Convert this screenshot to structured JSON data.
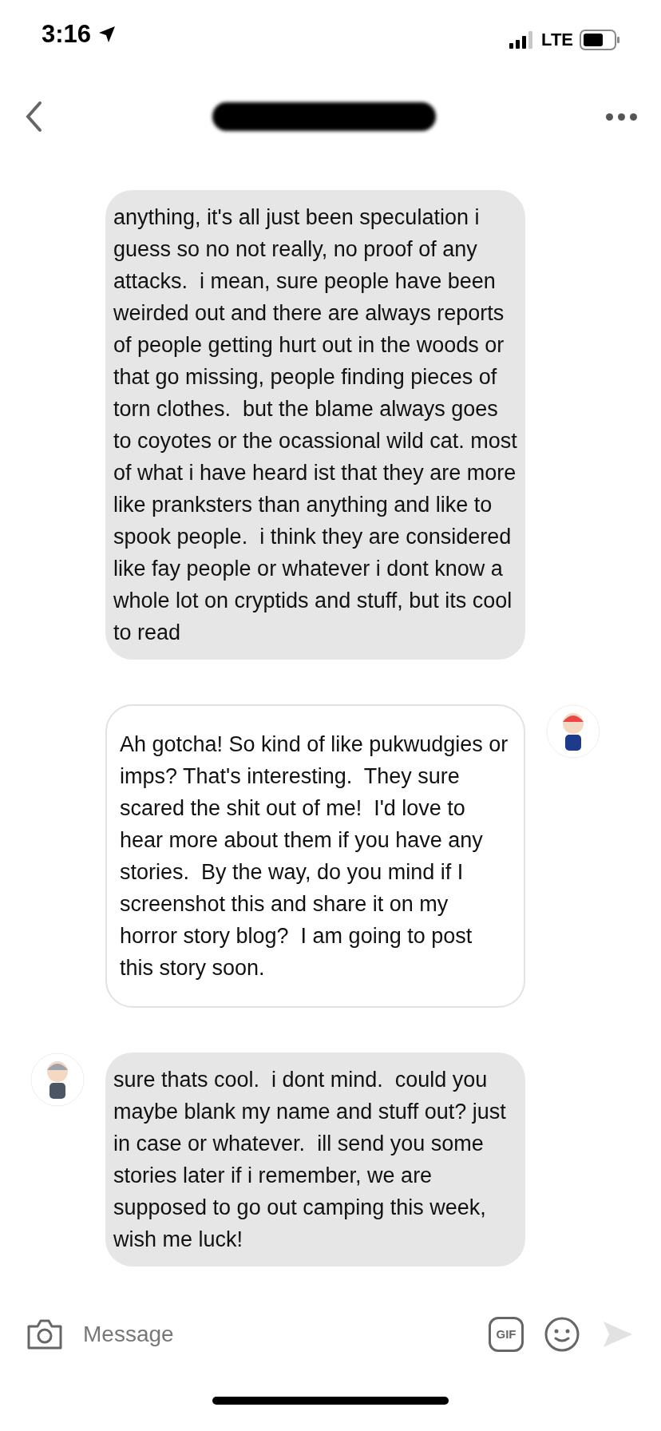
{
  "status_bar": {
    "time": "3:16",
    "network": "LTE"
  },
  "messages": [
    {
      "kind": "received",
      "avatar": false,
      "text": "anything, it's all just been speculation i guess so no not really, no proof of any attacks.  i mean, sure people have been weirded out and there are always reports of people getting hurt out in the woods or that go missing, people finding pieces of torn clothes.  but the blame always goes to coyotes or the ocassional wild cat. most of what i have heard ist that they are more like pranksters than anything and like to spook people.  i think they are considered like fay people or whatever i dont know a whole lot on cryptids and stuff, but its cool to read"
    },
    {
      "kind": "sent",
      "avatar": true,
      "text": "Ah gotcha! So kind of like pukwudgies or imps? That's interesting.  They sure scared the shit out of me!  I'd love to hear more about them if you have any stories.  By the way, do you mind if I screenshot this and share it on my horror story blog?  I am going to post this story soon."
    },
    {
      "kind": "received",
      "avatar": true,
      "text": "sure thats cool.  i dont mind.  could you maybe blank my name and stuff out? just in case or whatever.  ill send you some stories later if i remember, we are supposed to go out camping this week, wish me luck!"
    }
  ],
  "composer": {
    "placeholder": "Message",
    "gif_label": "GIF",
    "send_disabled": true
  }
}
